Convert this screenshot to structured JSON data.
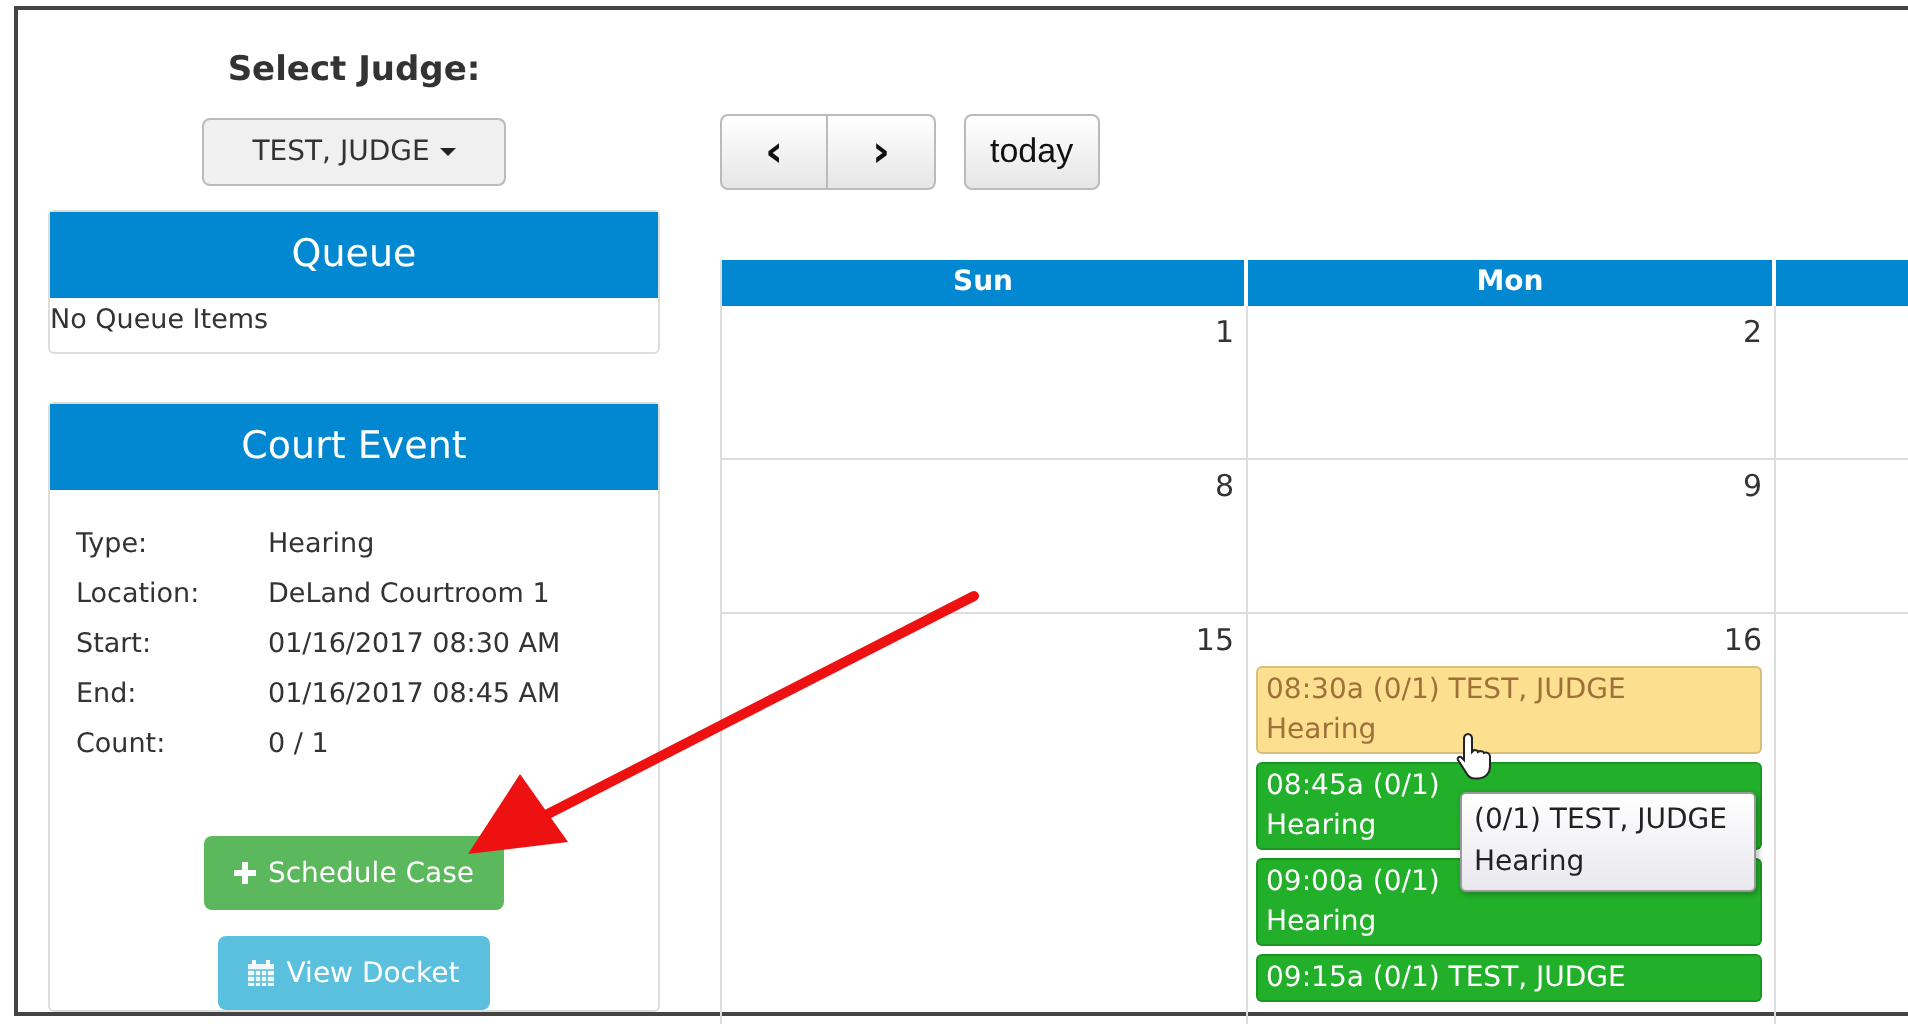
{
  "judge_select": {
    "label": "Select Judge:",
    "value": "TEST, JUDGE"
  },
  "queue": {
    "title": "Queue",
    "empty_text": "No Queue Items"
  },
  "court_event": {
    "title": "Court Event",
    "fields": [
      {
        "label": "Type:",
        "value": "Hearing"
      },
      {
        "label": "Location:",
        "value": "DeLand Courtroom 1"
      },
      {
        "label": "Start:",
        "value": "01/16/2017 08:30 AM"
      },
      {
        "label": "End:",
        "value": "01/16/2017 08:45 AM"
      },
      {
        "label": "Count:",
        "value": "0 / 1"
      }
    ],
    "buttons": [
      {
        "kind": "primary",
        "label": "Schedule Case"
      },
      {
        "kind": "info",
        "label": "View Docket"
      }
    ]
  },
  "calendar": {
    "nav": {
      "prev": "‹",
      "next": "›",
      "today": "today"
    },
    "columns": [
      "Sun",
      "Mon"
    ],
    "weeks": [
      {
        "days": [
          {
            "number": "1"
          },
          {
            "number": "2"
          }
        ]
      },
      {
        "days": [
          {
            "number": "8"
          },
          {
            "number": "9"
          }
        ]
      },
      {
        "days": [
          {
            "number": "15"
          },
          {
            "number": "16",
            "events": [
              {
                "title": "08:30a (0/1) TEST, JUDGE",
                "subtitle": "Hearing",
                "color": "#fde08f"
              },
              {
                "title": "08:45a (0/1)",
                "subtitle": "Hearing",
                "color": "#22b02a"
              },
              {
                "title": "09:00a (0/1)",
                "subtitle": "Hearing",
                "color": "#22b02a"
              },
              {
                "title": "09:15a (0/1) TEST, JUDGE",
                "color": "#22b02a"
              }
            ]
          }
        ]
      }
    ]
  },
  "tooltip": {
    "lines": [
      "(0/1) TEST, JUDGE",
      "Hearing"
    ]
  }
}
